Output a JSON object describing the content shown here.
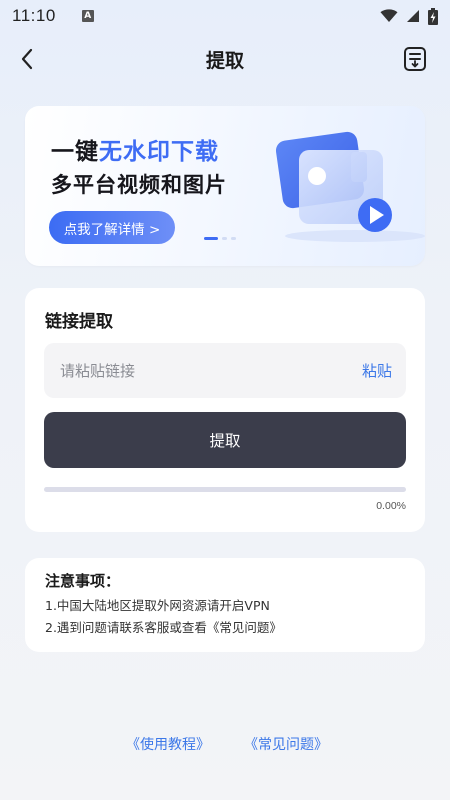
{
  "status_bar": {
    "time": "11:10",
    "notification_icon": "a-letter-icon",
    "wifi_icon": "wifi-icon",
    "signal_icon": "signal-icon",
    "battery_icon": "battery-charging-icon"
  },
  "nav": {
    "title": "提取",
    "back_icon": "chevron-left-icon",
    "history_icon": "list-download-icon"
  },
  "banner": {
    "line1_prefix": "一键",
    "line1_highlight": "无水印下载",
    "line2": "多平台视频和图片",
    "button_label": "点我了解详情 >",
    "illustration_icon": "video-play-icon",
    "accent_color": "#3e6cf4"
  },
  "extract": {
    "title": "链接提取",
    "input_placeholder": "请粘贴链接",
    "input_value": "",
    "paste_label": "粘贴",
    "button_label": "提取",
    "progress_fraction": 0,
    "progress_text": "0.00%"
  },
  "notes": {
    "title": "注意事项：",
    "items": [
      "1.中国大陆地区提取外网资源请开启VPN",
      "2.遇到问题请联系客服或查看《常见问题》"
    ]
  },
  "footer": {
    "tutorial_link": "《使用教程》",
    "faq_link": "《常见问题》"
  }
}
